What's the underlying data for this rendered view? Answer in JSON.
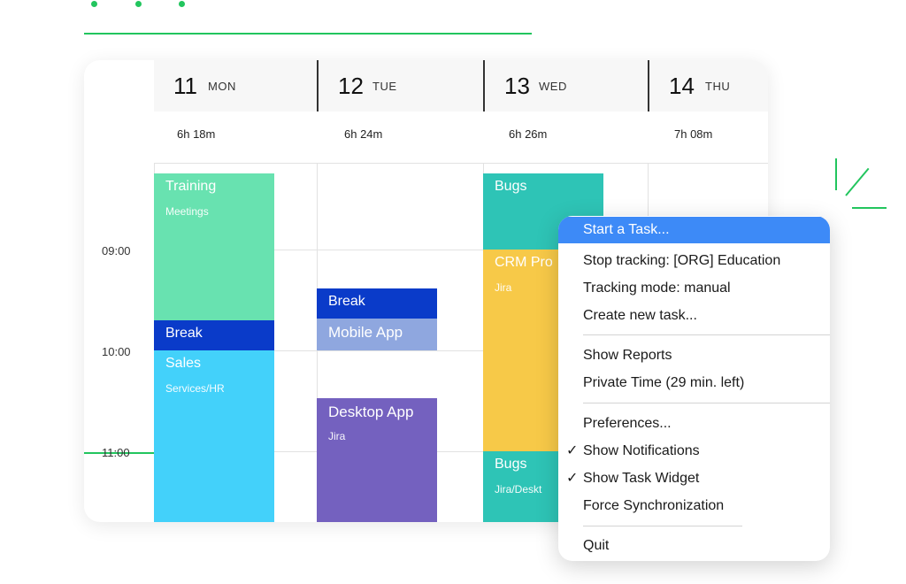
{
  "colors": {
    "accent_green": "#22c55e",
    "training": "#68e2b0",
    "break": "#0a3bc9",
    "sales": "#43d1fa",
    "mobile_app": "#8fa7df",
    "desktop_app": "#7461bf",
    "bugs": "#2ec4b6",
    "crm": "#f7c948",
    "menu_highlight": "#3d8af7"
  },
  "calendar": {
    "days": [
      {
        "num": "11",
        "dow": "MON",
        "total": "6h 18m"
      },
      {
        "num": "12",
        "dow": "TUE",
        "total": "6h 24m"
      },
      {
        "num": "13",
        "dow": "WED",
        "total": "6h 26m"
      },
      {
        "num": "14",
        "dow": "THU",
        "total": "7h 08m"
      }
    ],
    "times": [
      "09:00",
      "10:00",
      "11:00"
    ],
    "events": {
      "training": {
        "title": "Training",
        "sub": "Meetings"
      },
      "break_mon": {
        "title": "Break"
      },
      "sales": {
        "title": "Sales",
        "sub": "Services/HR"
      },
      "break_tue": {
        "title": "Break"
      },
      "mobile_app": {
        "title": "Mobile App"
      },
      "desktop_app": {
        "title": "Desktop App",
        "sub": "Jira"
      },
      "bugs_top": {
        "title": "Bugs"
      },
      "crm": {
        "title": "CRM Pro",
        "sub": "Jira"
      },
      "bugs_bottom": {
        "title": "Bugs",
        "sub": "Jira/Deskt"
      }
    }
  },
  "context_menu": {
    "items": [
      {
        "label": "Start a Task...",
        "active": true
      },
      {
        "label": "Stop tracking: [ORG] Education"
      },
      {
        "label": "Tracking mode: manual"
      },
      {
        "label": "Create new task..."
      },
      {
        "label": "Show Reports"
      },
      {
        "label": "Private Time (29 min. left)"
      },
      {
        "label": "Preferences..."
      },
      {
        "label": "Show Notifications",
        "checked": true
      },
      {
        "label": "Show Task Widget",
        "checked": true
      },
      {
        "label": "Force Synchronization"
      },
      {
        "label": "Quit"
      }
    ],
    "check_glyph": "✓"
  }
}
